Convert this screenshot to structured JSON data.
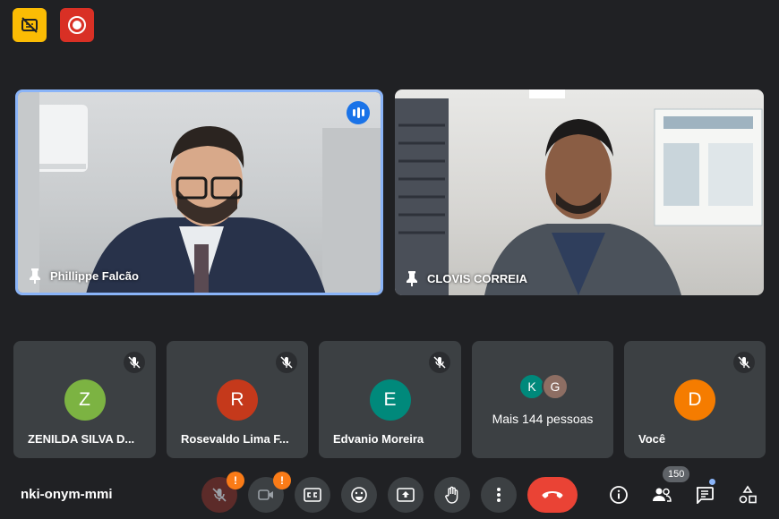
{
  "top_badges": [
    {
      "name": "captions-unavailable-icon",
      "color": "#fbbc04"
    },
    {
      "name": "record-icon",
      "color": "#d93025"
    }
  ],
  "video_tiles": [
    {
      "name": "Phillippe Falcão",
      "speaking": true,
      "pinned": true
    },
    {
      "name": "CLOVIS CORREIA",
      "speaking": false,
      "pinned": true
    }
  ],
  "participants": [
    {
      "initial": "Z",
      "name": "ZENILDA SILVA D...",
      "color": "#7cb342",
      "muted": true
    },
    {
      "initial": "R",
      "name": "Rosevaldo Lima F...",
      "color": "#c5391b",
      "muted": true
    },
    {
      "initial": "E",
      "name": "Edvanio Moreira",
      "color": "#00897b",
      "muted": true
    },
    {
      "initial": "D",
      "name": "Você",
      "color": "#f57c00",
      "muted": true
    }
  ],
  "more_people": {
    "label": "Mais 144 pessoas",
    "avatars": [
      {
        "initial": "K",
        "color": "#00897b"
      },
      {
        "initial": "G",
        "color": "#8d6e63"
      }
    ]
  },
  "meeting_code": "nki-onym-mmi",
  "toolbar": {
    "mic_warning": "!",
    "camera_warning": "!",
    "participant_count": "150"
  },
  "colors": {
    "background": "#202124",
    "tile": "#3c4043",
    "active_speaker": "#8ab4f8",
    "end_call": "#ea4335"
  }
}
